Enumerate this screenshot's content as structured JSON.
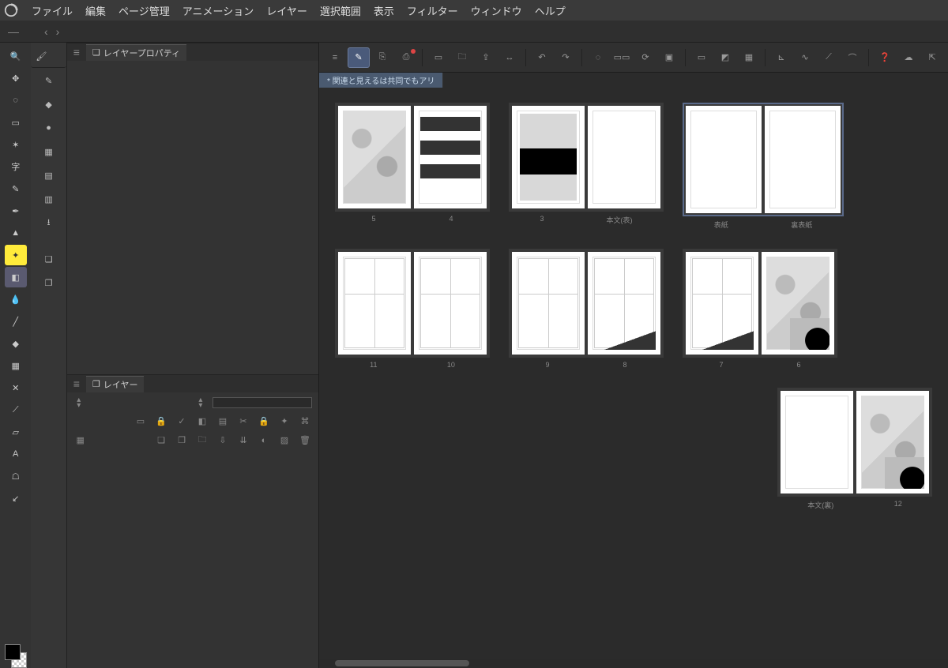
{
  "menu": {
    "items": [
      "ファイル",
      "編集",
      "ページ管理",
      "アニメーション",
      "レイヤー",
      "選択範囲",
      "表示",
      "フィルター",
      "ウィンドウ",
      "ヘルプ"
    ]
  },
  "panels": {
    "layerProperty": {
      "title": "レイヤープロパティ"
    },
    "layer": {
      "title": "レイヤー"
    }
  },
  "docTab": {
    "title": "* 関連と見えるは共同でもアリ"
  },
  "leftTools": [
    {
      "name": "magnifier-icon",
      "glyph": "🔍"
    },
    {
      "name": "move-cube-icon",
      "glyph": "✥"
    },
    {
      "name": "lasso-icon",
      "glyph": "◌"
    },
    {
      "name": "marquee-icon",
      "glyph": "▭"
    },
    {
      "name": "wand-icon",
      "glyph": "✶"
    },
    {
      "name": "text-mask-icon",
      "glyph": "字",
      "sel": false,
      "bright": false
    },
    {
      "name": "eyedropper-icon",
      "glyph": "✎"
    },
    {
      "name": "pen-icon",
      "glyph": "✒"
    },
    {
      "name": "brush-icon",
      "glyph": "▲"
    },
    {
      "name": "sparkle-icon",
      "glyph": "✦",
      "bright": true
    },
    {
      "name": "eraser-icon",
      "glyph": "◧",
      "sel": true
    },
    {
      "name": "blend-icon",
      "glyph": "💧"
    },
    {
      "name": "line-icon",
      "glyph": "╱"
    },
    {
      "name": "fill-icon",
      "glyph": "◆"
    },
    {
      "name": "gradient-icon",
      "glyph": "▦"
    },
    {
      "name": "decoration-icon",
      "glyph": "✕"
    },
    {
      "name": "ruler-icon",
      "glyph": "⟋"
    },
    {
      "name": "frame-icon",
      "glyph": "▱"
    },
    {
      "name": "text-icon",
      "glyph": "A"
    },
    {
      "name": "balloon-icon",
      "glyph": "☖"
    },
    {
      "name": "correct-icon",
      "glyph": "↙"
    }
  ],
  "subTools": [
    {
      "name": "subtool-pen-icon",
      "glyph": "✎"
    },
    {
      "name": "subtool-block-icon",
      "glyph": "◆"
    },
    {
      "name": "subtool-soft-icon",
      "glyph": "●"
    },
    {
      "name": "subtool-tone-icon",
      "glyph": "▦"
    },
    {
      "name": "subtool-panel-icon",
      "glyph": "▤"
    },
    {
      "name": "subtool-film-icon",
      "glyph": "▥"
    },
    {
      "name": "subtool-download-icon",
      "glyph": "⭳"
    },
    {
      "name": "subtool-layers-add-icon",
      "glyph": "❏"
    },
    {
      "name": "subtool-layers-icon",
      "glyph": "❐"
    }
  ],
  "canvasToolbar": [
    {
      "name": "list-icon",
      "glyph": "≡"
    },
    {
      "name": "edit-page-icon",
      "glyph": "✎",
      "sel": true
    },
    {
      "name": "spread-icon",
      "glyph": "⎘"
    },
    {
      "name": "binding-icon",
      "glyph": "⎙",
      "dot": true
    },
    {
      "sep": true
    },
    {
      "name": "open-page-icon",
      "glyph": "▭"
    },
    {
      "name": "open-folder-icon",
      "glyph": "🗀"
    },
    {
      "name": "export-icon",
      "glyph": "⇪"
    },
    {
      "name": "arrows-icon",
      "glyph": "↔"
    },
    {
      "sep": true
    },
    {
      "name": "undo-icon",
      "glyph": "↶"
    },
    {
      "name": "redo-icon",
      "glyph": "↷"
    },
    {
      "sep": true
    },
    {
      "name": "loading-icon",
      "glyph": "◌"
    },
    {
      "name": "pages-icon",
      "glyph": "▭▭"
    },
    {
      "name": "sync-icon",
      "glyph": "⟳"
    },
    {
      "name": "crop-icon",
      "glyph": "▣"
    },
    {
      "sep": true
    },
    {
      "name": "sel-rect-icon",
      "glyph": "▭"
    },
    {
      "name": "fill-sel-icon",
      "glyph": "◩"
    },
    {
      "name": "opt-icon",
      "glyph": "▦"
    },
    {
      "sep": true
    },
    {
      "name": "path-a-icon",
      "glyph": "⊾"
    },
    {
      "name": "path-b-icon",
      "glyph": "∿"
    },
    {
      "name": "path-c-icon",
      "glyph": "⟋"
    },
    {
      "name": "path-d-icon",
      "glyph": "⌒"
    },
    {
      "sep": true
    },
    {
      "name": "help-icon",
      "glyph": "❓"
    },
    {
      "name": "cloud-icon",
      "glyph": "☁"
    },
    {
      "name": "upload-icon",
      "glyph": "⇱"
    }
  ],
  "layerIconsTop": [
    {
      "name": "ref-icon",
      "glyph": "▭"
    },
    {
      "name": "lock-icon",
      "glyph": "🔒"
    },
    {
      "name": "check-a-icon",
      "glyph": "✓"
    },
    {
      "name": "color-icon",
      "glyph": "◧"
    },
    {
      "name": "mask-a-icon",
      "glyph": "▤"
    },
    {
      "name": "link-icon",
      "glyph": "✂"
    },
    {
      "name": "lock2-icon",
      "glyph": "🔒"
    },
    {
      "name": "ghost-icon",
      "glyph": "✦"
    },
    {
      "name": "link2-icon",
      "glyph": "⌘"
    }
  ],
  "layerIconsBot": [
    {
      "name": "table-icon",
      "glyph": "▦"
    },
    {
      "name": "new-layer-icon",
      "glyph": "❏"
    },
    {
      "name": "dup-icon",
      "glyph": "❐"
    },
    {
      "name": "folder-icon",
      "glyph": "🗀"
    },
    {
      "name": "move-down-icon",
      "glyph": "⇩"
    },
    {
      "name": "merge-icon",
      "glyph": "⇊"
    },
    {
      "name": "mask-b-icon",
      "glyph": "◐"
    },
    {
      "name": "halftone-icon",
      "glyph": "▨"
    },
    {
      "name": "trash-icon",
      "glyph": "🗑"
    }
  ],
  "spreads": [
    {
      "row": 0,
      "labels": [
        "5",
        "4"
      ],
      "pages": [
        {
          "art": "art-manga"
        },
        {
          "art": "art-bars"
        }
      ]
    },
    {
      "row": 0,
      "labels": [
        "3",
        "本文(表)"
      ],
      "pages": [
        {
          "art": "art-panel"
        },
        {
          "art": ""
        }
      ]
    },
    {
      "row": 0,
      "labels": [
        "表紙",
        "裏表紙"
      ],
      "pages": [
        {
          "art": "",
          "dbl": true
        },
        {
          "art": "",
          "dbl": true
        }
      ],
      "highlight": true
    },
    {
      "row": 1,
      "labels": [
        "11",
        "10"
      ],
      "pages": [
        {
          "art": "art-grid"
        },
        {
          "art": "art-grid"
        }
      ]
    },
    {
      "row": 1,
      "labels": [
        "9",
        "8"
      ],
      "pages": [
        {
          "art": "art-grid"
        },
        {
          "art": "art-grid art-tri"
        }
      ]
    },
    {
      "row": 1,
      "labels": [
        "7",
        "6"
      ],
      "pages": [
        {
          "art": "art-grid art-tri"
        },
        {
          "art": "art-manga art-dark-corner"
        }
      ]
    },
    {
      "row": 2,
      "labels": [
        "本文(裏)",
        "12"
      ],
      "pages": [
        {
          "art": ""
        },
        {
          "art": "art-manga art-dark-corner"
        }
      ]
    }
  ],
  "colors": {
    "accent": "#4a5a7a",
    "bg": "#2b2b2b",
    "panel": "#333333"
  }
}
